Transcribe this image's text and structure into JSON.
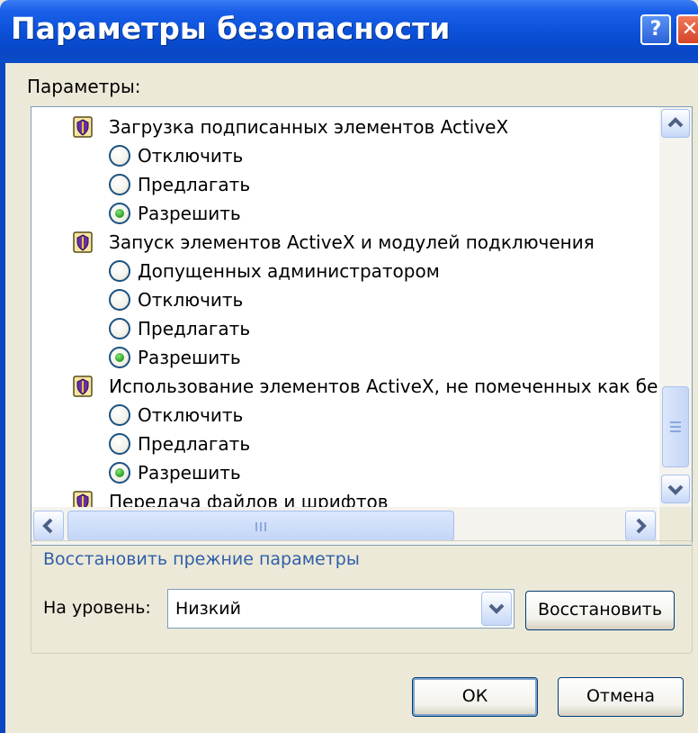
{
  "window": {
    "title": "Параметры безопасности",
    "help_glyph": "?",
    "close_glyph": "✕"
  },
  "params_label": "Параметры:",
  "tree": {
    "groups": [
      {
        "label": "Загрузка подписанных элементов ActiveX",
        "options": [
          {
            "label": "Отключить",
            "selected": false
          },
          {
            "label": "Предлагать",
            "selected": false
          },
          {
            "label": "Разрешить",
            "selected": true
          }
        ]
      },
      {
        "label": "Запуск элементов ActiveX и модулей подключения",
        "options": [
          {
            "label": "Допущенных администратором",
            "selected": false
          },
          {
            "label": "Отключить",
            "selected": false
          },
          {
            "label": "Предлагать",
            "selected": false
          },
          {
            "label": "Разрешить",
            "selected": true
          }
        ]
      },
      {
        "label": "Использование элементов ActiveX, не помеченных как безс",
        "options": [
          {
            "label": "Отключить",
            "selected": false
          },
          {
            "label": "Предлагать",
            "selected": false
          },
          {
            "label": "Разрешить",
            "selected": true
          }
        ]
      }
    ],
    "partial_group": "Передача файлов и шрифтов"
  },
  "restore": {
    "title": "Восстановить прежние параметры",
    "level_label": "На уровень:",
    "level_value": "Низкий",
    "restore_button": "Восстановить"
  },
  "footer": {
    "ok": "ОК",
    "cancel": "Отмена"
  },
  "colors": {
    "titlebar": "#0a4fd6",
    "dialog_bg": "#ece9d8",
    "group_title": "#2f5fa8",
    "radio_selected": "#21a121"
  },
  "icons": {
    "group": "settings-shield-icon",
    "scroll_up": "chevron-up-icon",
    "scroll_down": "chevron-down-icon",
    "scroll_left": "chevron-left-icon",
    "scroll_right": "chevron-right-icon",
    "dropdown": "chevron-down-icon"
  }
}
